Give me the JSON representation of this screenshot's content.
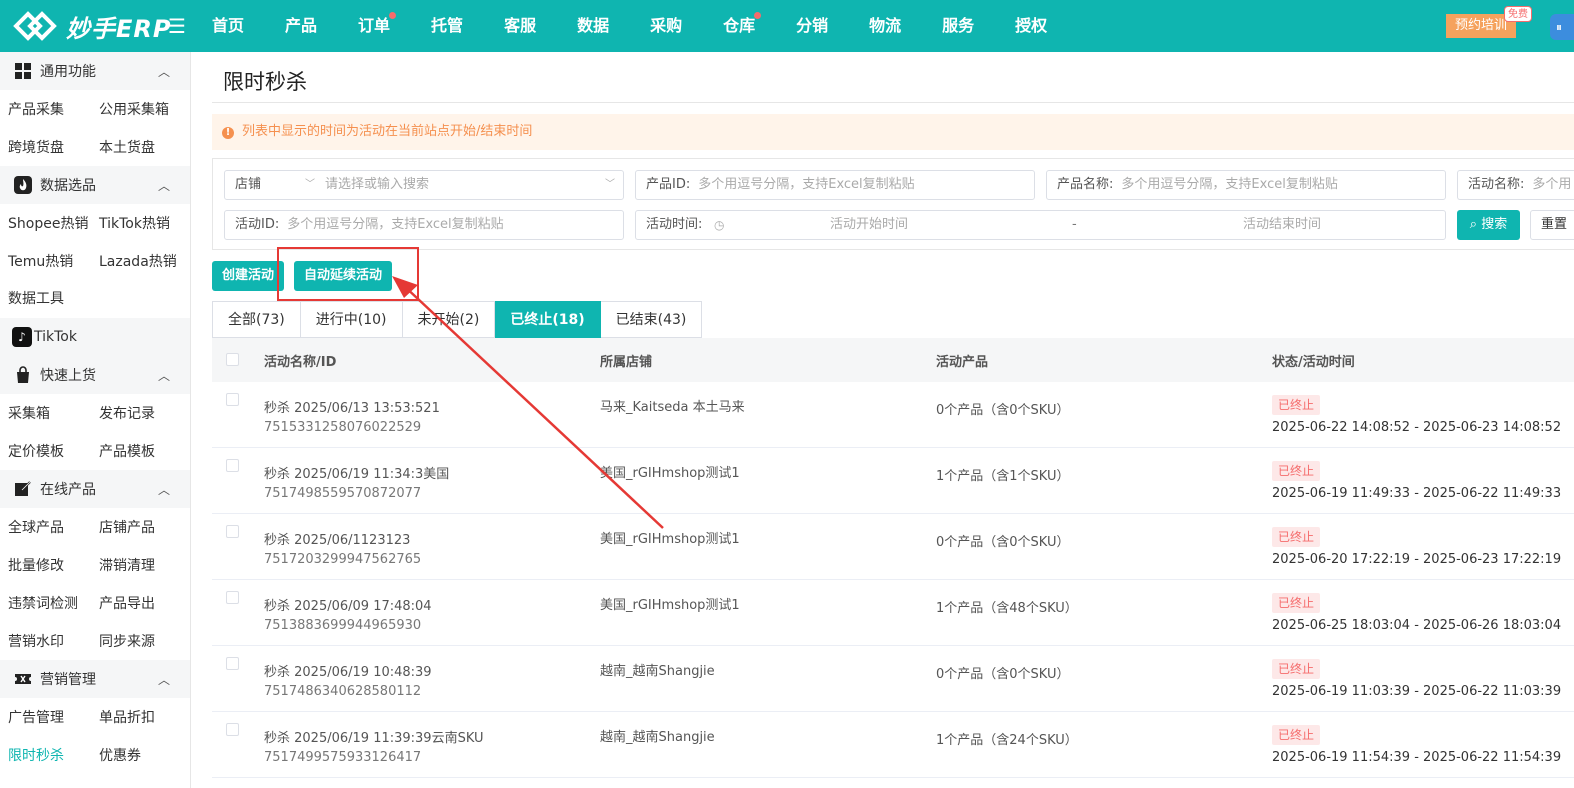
{
  "app": {
    "name": "妙手ERP"
  },
  "nav": [
    {
      "label": "首页",
      "dot": false
    },
    {
      "label": "产品",
      "dot": false
    },
    {
      "label": "订单",
      "dot": true
    },
    {
      "label": "托管",
      "dot": false
    },
    {
      "label": "客服",
      "dot": false
    },
    {
      "label": "数据",
      "dot": false
    },
    {
      "label": "采购",
      "dot": false
    },
    {
      "label": "仓库",
      "dot": true
    },
    {
      "label": "分销",
      "dot": false
    },
    {
      "label": "物流",
      "dot": false
    },
    {
      "label": "服务",
      "dot": false
    },
    {
      "label": "授权",
      "dot": false
    }
  ],
  "topbar": {
    "training": "预约培训",
    "free": "免费"
  },
  "sidebar": {
    "groups": [
      {
        "title": "通用功能",
        "items": [
          [
            "产品采集",
            "公用采集箱"
          ],
          [
            "跨境货盘",
            "本土货盘"
          ]
        ]
      },
      {
        "title": "数据选品",
        "items": [
          [
            "Shopee热销",
            "TikTok热销"
          ],
          [
            "Temu热销",
            "Lazada热销"
          ]
        ],
        "extra": "数据工具",
        "tiktok": "TikTok"
      },
      {
        "title": "快速上货",
        "items": [
          [
            "采集箱",
            "发布记录"
          ],
          [
            "定价模板",
            "产品模板"
          ]
        ]
      },
      {
        "title": "在线产品",
        "items": [
          [
            "全球产品",
            "店铺产品"
          ],
          [
            "批量修改",
            "滞销清理"
          ],
          [
            "违禁词检测",
            "产品导出"
          ],
          [
            "营销水印",
            "同步来源"
          ]
        ]
      },
      {
        "title": "营销管理",
        "items": [
          [
            "广告管理",
            "单品折扣"
          ],
          [
            "限时秒杀",
            "优惠券"
          ]
        ]
      }
    ]
  },
  "page": {
    "title": "限时秒杀",
    "notice": "列表中显示的时间为活动在当前站点开始/结束时间",
    "filters": {
      "shop_label": "店铺",
      "shop_placeholder": "请选择或输入搜索",
      "pid_label": "产品ID:",
      "pid_placeholder": "多个用逗号分隔，支持Excel复制粘贴",
      "pname_label": "产品名称:",
      "pname_placeholder": "多个用逗号分隔，支持Excel复制粘贴",
      "aname_label": "活动名称:",
      "aname_placeholder": "多个用",
      "aid_label": "活动ID:",
      "aid_placeholder": "多个用逗号分隔，支持Excel复制粘贴",
      "atime_label": "活动时间:",
      "start_placeholder": "活动开始时间",
      "dash": "-",
      "end_placeholder": "活动结束时间",
      "search": "搜索",
      "reset": "重置"
    },
    "actions": {
      "create": "创建活动",
      "auto_extend": "自动延续活动"
    },
    "tabs": [
      {
        "label": "全部(73)",
        "active": false
      },
      {
        "label": "进行中(10)",
        "active": false
      },
      {
        "label": "未开始(2)",
        "active": false
      },
      {
        "label": "已终止(18)",
        "active": true
      },
      {
        "label": "已结束(43)",
        "active": false
      }
    ],
    "table": {
      "headers": [
        "活动名称/ID",
        "所属店铺",
        "活动产品",
        "状态/活动时间"
      ],
      "rows": [
        {
          "name": "秒杀 2025/06/13 13:53:521",
          "id": "7515331258076022529",
          "shop": "马来_Kaitseda 本土马来",
          "products": "0个产品（含0个SKU）",
          "status": "已终止",
          "time": "2025-06-22 14:08:52 - 2025-06-23 14:08:52"
        },
        {
          "name": "秒杀 2025/06/19 11:34:3美国",
          "id": "7517498559570872077",
          "shop": "美国_rGIHmshop测试1",
          "products": "1个产品（含1个SKU）",
          "status": "已终止",
          "time": "2025-06-19 11:49:33 - 2025-06-22 11:49:33"
        },
        {
          "name": "秒杀 2025/06/1123123",
          "id": "7517203299947562765",
          "shop": "美国_rGIHmshop测试1",
          "products": "0个产品（含0个SKU）",
          "status": "已终止",
          "time": "2025-06-20 17:22:19 - 2025-06-23 17:22:19"
        },
        {
          "name": "秒杀 2025/06/09 17:48:04",
          "id": "7513883699944965930",
          "shop": "美国_rGIHmshop测试1",
          "products": "1个产品（含48个SKU）",
          "status": "已终止",
          "time": "2025-06-25 18:03:04 - 2025-06-26 18:03:04"
        },
        {
          "name": "秒杀 2025/06/19 10:48:39",
          "id": "7517486340628580112",
          "shop": "越南_越南Shangjie",
          "products": "0个产品（含0个SKU）",
          "status": "已终止",
          "time": "2025-06-19 11:03:39 - 2025-06-22 11:03:39"
        },
        {
          "name": "秒杀 2025/06/19 11:39:39云南SKU",
          "id": "7517499575933126417",
          "shop": "越南_越南Shangjie",
          "products": "1个产品（含24个SKU）",
          "status": "已终止",
          "time": "2025-06-19 11:54:39 - 2025-06-22 11:54:39"
        }
      ]
    }
  },
  "colors": {
    "brand": "#0fb5b0",
    "annotation": "#e53935",
    "status_bg": "#fde8e8",
    "status_text": "#f56c6c"
  }
}
